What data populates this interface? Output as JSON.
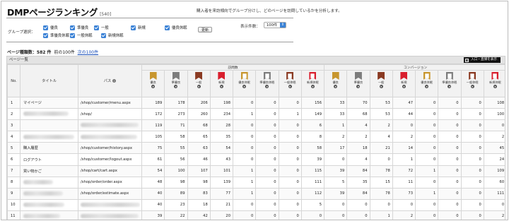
{
  "header": {
    "title": "DMPページランキング",
    "count": "[540]",
    "description": "購入者を来訪傾向でグループ分けし、どのページを訪問しているかを分析します。"
  },
  "filters": {
    "group_label": "グループ選択：",
    "checkboxes": [
      "優良",
      "準優良",
      "一般",
      "新規",
      "優良休眠",
      "準優良休眠",
      "一般休眠",
      "新規休眠"
    ],
    "update_button": "更新",
    "display_count_label": "表示件数：",
    "display_count_value": "100件"
  },
  "stats": {
    "prefix": "ページ種類数：",
    "total": "582 件",
    "range": "前の100件",
    "next_link": "次の100件"
  },
  "panel": {
    "title": "ページ一覧",
    "action_button": "入口・直帰を表示"
  },
  "table": {
    "col_no": "No.",
    "col_title": "タイトル",
    "col_path": "パス",
    "group_visits": "訪問数",
    "group_conversion": "コンバージョン",
    "segments": [
      {
        "label": "優良",
        "color": "#c8962e",
        "style": "fill"
      },
      {
        "label": "準優良",
        "color": "#7d7d7d",
        "style": "fill"
      },
      {
        "label": "一般",
        "color": "#8a3a22",
        "style": "fill"
      },
      {
        "label": "新規",
        "color": "#d91f2e",
        "style": "fill"
      },
      {
        "label": "優良休眠",
        "color": "#c8962e",
        "style": "outline"
      },
      {
        "label": "準優良休眠",
        "color": "#7d7d7d",
        "style": "outline"
      },
      {
        "label": "一般休眠",
        "color": "#8a3a22",
        "style": "outline"
      },
      {
        "label": "新規休眠",
        "color": "#d91f2e",
        "style": "outline"
      }
    ],
    "rows": [
      {
        "no": "1",
        "title": "マイページ",
        "path": "/shop/customer/menu.aspx",
        "visits": [
          "189",
          "178",
          "206",
          "198",
          "0",
          "0",
          "0",
          "156"
        ],
        "cv": [
          "33",
          "70",
          "53",
          "47",
          "0",
          "0",
          "0",
          "108"
        ]
      },
      {
        "no": "2",
        "title": "",
        "path": "/shop/",
        "visits": [
          "172",
          "273",
          "260",
          "234",
          "1",
          "0",
          "1",
          "149"
        ],
        "cv": [
          "33",
          "68",
          "53",
          "44",
          "0",
          "0",
          "0",
          "100"
        ]
      },
      {
        "no": "3",
        "title": "",
        "path": "",
        "visits": [
          "119",
          "71",
          "68",
          "28",
          "0",
          "0",
          "0",
          "6"
        ],
        "cv": [
          "1",
          "4",
          "2",
          "0",
          "0",
          "0",
          "0",
          "0"
        ]
      },
      {
        "no": "4",
        "title": "",
        "path": "",
        "visits": [
          "105",
          "58",
          "65",
          "35",
          "0",
          "0",
          "0",
          "8"
        ],
        "cv": [
          "2",
          "2",
          "4",
          "2",
          "0",
          "0",
          "0",
          "2"
        ]
      },
      {
        "no": "5",
        "title": "購入履歴",
        "path": "/shop/customer/history.aspx",
        "visits": [
          "75",
          "55",
          "63",
          "54",
          "0",
          "0",
          "0",
          "58"
        ],
        "cv": [
          "17",
          "18",
          "21",
          "14",
          "0",
          "0",
          "0",
          "45"
        ]
      },
      {
        "no": "6",
        "title": "ログアウト",
        "path": "/shop/customer/logout.aspx",
        "visits": [
          "61",
          "56",
          "46",
          "43",
          "0",
          "0",
          "0",
          "39"
        ],
        "cv": [
          "0",
          "4",
          "0",
          "1",
          "0",
          "0",
          "0",
          "24"
        ]
      },
      {
        "no": "7",
        "title": "買い物かご",
        "path": "/shop/cart/cart.aspx",
        "visits": [
          "54",
          "100",
          "107",
          "101",
          "1",
          "0",
          "0",
          "115"
        ],
        "cv": [
          "39",
          "84",
          "78",
          "72",
          "1",
          "0",
          "0",
          "109"
        ]
      },
      {
        "no": "8",
        "title": "",
        "path": "/shop/order/order.aspx",
        "visits": [
          "48",
          "98",
          "98",
          "139",
          "1",
          "0",
          "0",
          "111"
        ],
        "cv": [
          "5",
          "35",
          "15",
          "11",
          "0",
          "0",
          "0",
          "60"
        ]
      },
      {
        "no": "9",
        "title": "",
        "path": "/shop/order/estimate.aspx",
        "visits": [
          "40",
          "89",
          "83",
          "77",
          "1",
          "0",
          "0",
          "112"
        ],
        "cv": [
          "39",
          "84",
          "78",
          "73",
          "1",
          "0",
          "0",
          "111"
        ]
      },
      {
        "no": "10",
        "title": "",
        "path": "",
        "visits": [
          "40",
          "23",
          "18",
          "21",
          "0",
          "0",
          "0",
          "5"
        ],
        "cv": [
          "0",
          "0",
          "0",
          "0",
          "0",
          "0",
          "0",
          "0"
        ]
      },
      {
        "no": "11",
        "title": "",
        "path": "",
        "visits": [
          "39",
          "22",
          "42",
          "20",
          "0",
          "0",
          "0",
          "0"
        ],
        "cv": [
          "0",
          "0",
          "1",
          "2",
          "0",
          "0",
          "0",
          "2"
        ]
      }
    ]
  }
}
